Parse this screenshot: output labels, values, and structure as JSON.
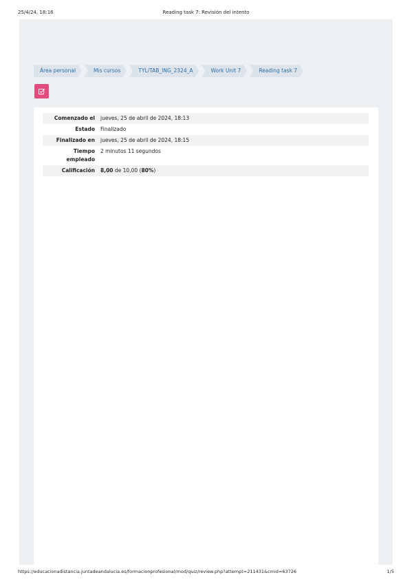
{
  "print_header": {
    "date": "25/4/24, 18:16",
    "title": "Reading task 7: Revisión del intento"
  },
  "breadcrumb": [
    "Área personal",
    "Mis cursos",
    "TYL/TAB_ING_2324_A",
    "Work Unit 7",
    "Reading task 7"
  ],
  "summary": {
    "started_label": "Comenzado el",
    "started_value": "jueves, 25 de abril de 2024, 18:13",
    "state_label": "Estado",
    "state_value": "Finalizado",
    "finished_label": "Finalizado en",
    "finished_value": "jueves, 25 de abril de 2024, 18:15",
    "time_label": "Tiempo empleado",
    "time_value": "2 minutos 11 segundos",
    "grade_label": "Calificación",
    "grade_score": "8,00",
    "grade_of": "de 10,00",
    "grade_percent": "80%"
  },
  "print_footer": {
    "url": "https://educacionadistancia.juntadeandalucia.es/formacionprofesional/mod/quiz/review.php?attempt=211431&cmid=63726",
    "page": "1/5"
  },
  "colors": {
    "quiz_icon_bg": "#e34b7f",
    "breadcrumb_link": "#2b6ea8",
    "page_bg": "#eef1f4"
  },
  "icons": {
    "activity": "quiz-icon"
  }
}
